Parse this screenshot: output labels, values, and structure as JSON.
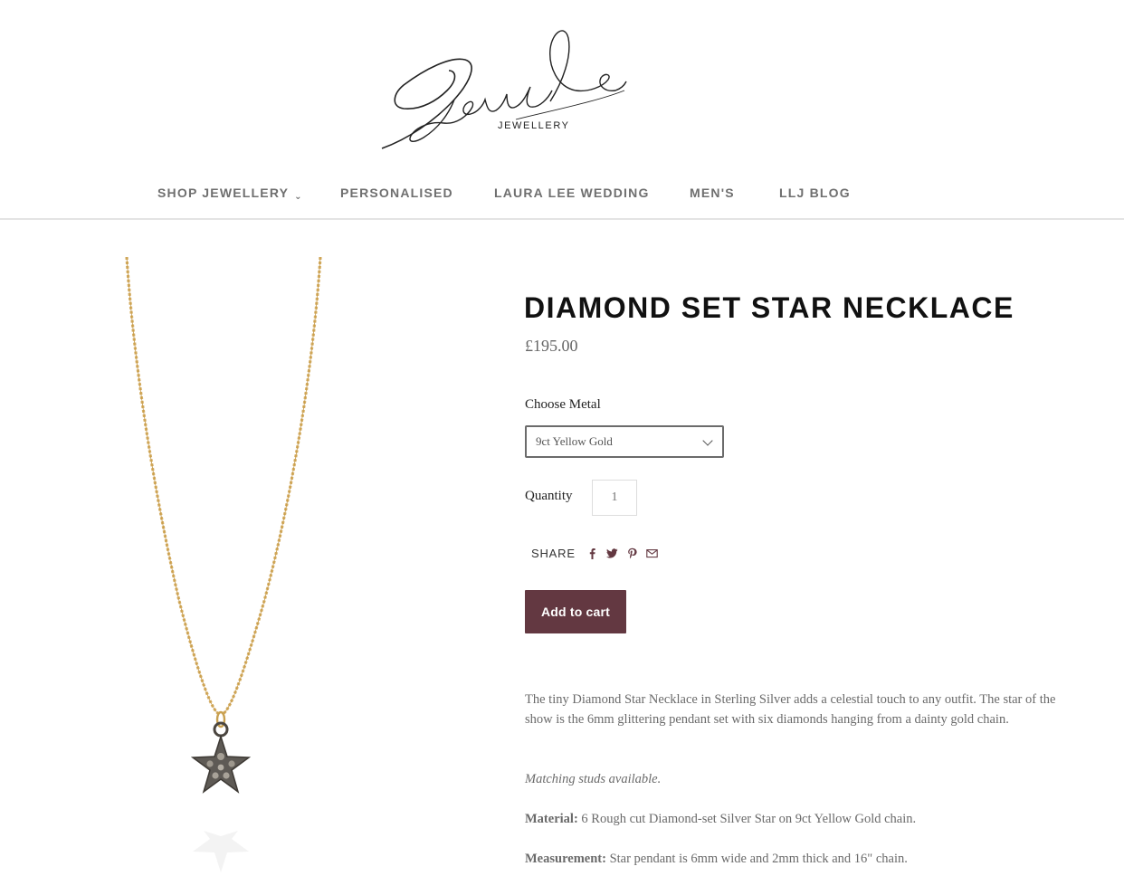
{
  "header": {
    "logo_script": "Laura Lee",
    "logo_subtitle": "JEWELLERY"
  },
  "nav": {
    "items": [
      {
        "label": "SHOP JEWELLERY",
        "has_dropdown": true
      },
      {
        "label": "PERSONALISED",
        "has_dropdown": false
      },
      {
        "label": "LAURA LEE WEDDING",
        "has_dropdown": false
      },
      {
        "label": "MEN'S",
        "has_dropdown": false
      },
      {
        "label": "LLJ BLOG",
        "has_dropdown": false
      }
    ],
    "dropdown_icon": "chevron-down-icon"
  },
  "product": {
    "title": "DIAMOND SET STAR NECKLACE",
    "price": "£195.00",
    "metal_label": "Choose Metal",
    "metal_selected": "9ct Yellow Gold",
    "quantity_label": "Quantity",
    "quantity_value": "1",
    "share_label": "SHARE",
    "share_icons": [
      "facebook-icon",
      "twitter-icon",
      "pinterest-icon",
      "email-icon"
    ],
    "add_to_cart_label": "Add to cart",
    "add_to_cart_color": "#633841",
    "description": {
      "intro": "The tiny Diamond Star Necklace in Sterling Silver adds a celestial touch to any outfit. The star of the show is the 6mm glittering pendant set with six diamonds hanging from a dainty gold chain.",
      "matching": "Matching studs available.",
      "material_label": "Material:",
      "material_value": " 6 Rough cut Diamond-set Silver Star on 9ct Yellow Gold chain.",
      "measurement_label": "Measurement:",
      "measurement_value": " Star pendant is 6mm wide and 2mm thick and 16\" chain."
    }
  }
}
